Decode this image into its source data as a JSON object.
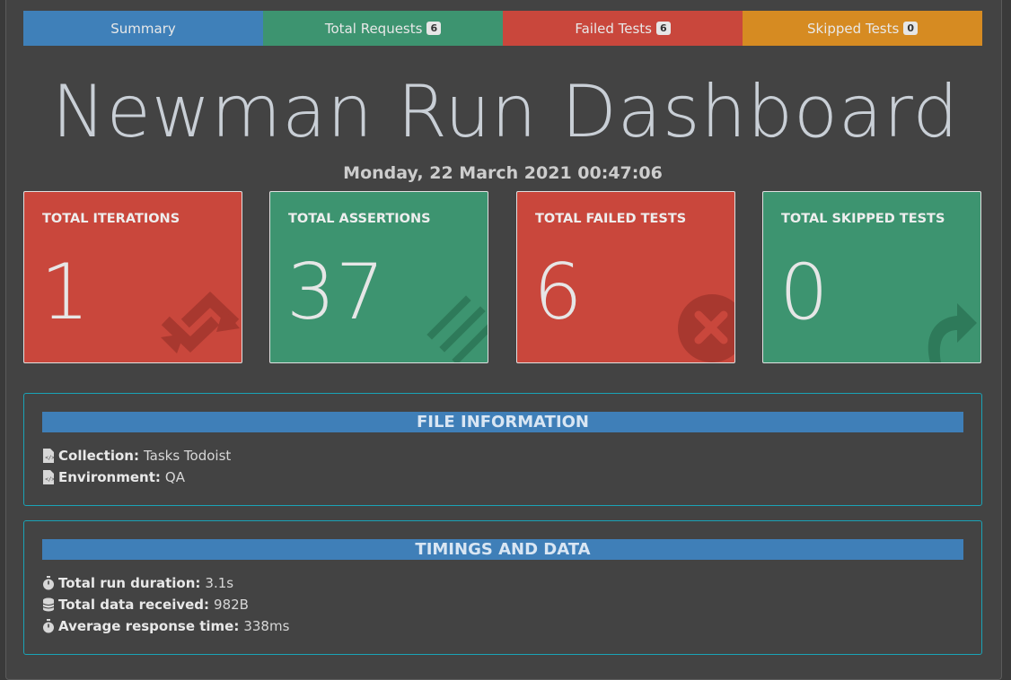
{
  "tabs": [
    {
      "label": "Summary",
      "badge": null,
      "color": "#3f80b9"
    },
    {
      "label": "Total Requests",
      "badge": "6",
      "color": "#3d9470"
    },
    {
      "label": "Failed Tests",
      "badge": "6",
      "color": "#c9473c"
    },
    {
      "label": "Skipped Tests",
      "badge": "0",
      "color": "#d68b22"
    }
  ],
  "header": {
    "title": "Newman Run Dashboard",
    "date": "Monday, 22 March 2021 00:47:06"
  },
  "cards": [
    {
      "label": "TOTAL ITERATIONS",
      "value": "1",
      "color": "#c9473c",
      "icon": "sync-icon"
    },
    {
      "label": "TOTAL ASSERTIONS",
      "value": "37",
      "color": "#3d9470",
      "icon": "stream-icon"
    },
    {
      "label": "TOTAL FAILED TESTS",
      "value": "6",
      "color": "#c9473c",
      "icon": "times-circle-icon"
    },
    {
      "label": "TOTAL SKIPPED TESTS",
      "value": "0",
      "color": "#3d9470",
      "icon": "share-arrow-icon"
    }
  ],
  "file_info": {
    "heading": "FILE INFORMATION",
    "collection_label": "Collection:",
    "collection_value": "Tasks Todoist",
    "environment_label": "Environment:",
    "environment_value": "QA"
  },
  "timings": {
    "heading": "TIMINGS AND DATA",
    "duration_label": "Total run duration:",
    "duration_value": "3.1s",
    "data_label": "Total data received:",
    "data_value": "982B",
    "response_label": "Average response time:",
    "response_value": "338ms"
  }
}
